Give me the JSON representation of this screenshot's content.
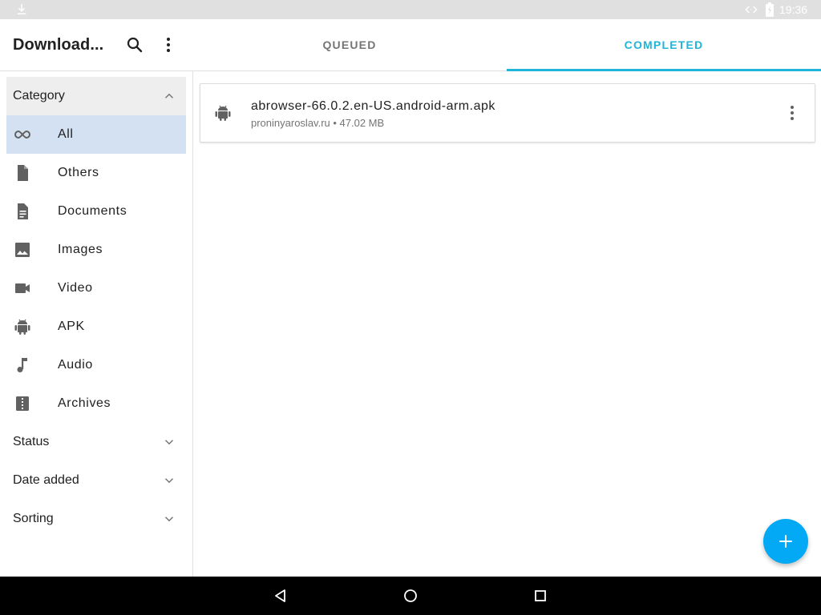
{
  "status_bar": {
    "time": "19:36",
    "icons": [
      "download-icon",
      "code-icon",
      "battery-icon"
    ]
  },
  "app_bar": {
    "title": "Download...",
    "search_icon": "search-icon",
    "overflow_icon": "more-vert-icon",
    "tabs": [
      {
        "label": "QUEUED",
        "active": false
      },
      {
        "label": "COMPLETED",
        "active": true
      }
    ]
  },
  "sidebar": {
    "category": {
      "label": "Category",
      "expanded": true,
      "items": [
        {
          "label": "All",
          "icon": "infinity-icon",
          "selected": true
        },
        {
          "label": "Others",
          "icon": "file-icon",
          "selected": false
        },
        {
          "label": "Documents",
          "icon": "document-icon",
          "selected": false
        },
        {
          "label": "Images",
          "icon": "image-icon",
          "selected": false
        },
        {
          "label": "Video",
          "icon": "video-icon",
          "selected": false
        },
        {
          "label": "APK",
          "icon": "android-icon",
          "selected": false
        },
        {
          "label": "Audio",
          "icon": "music-note-icon",
          "selected": false
        },
        {
          "label": "Archives",
          "icon": "archive-icon",
          "selected": false
        }
      ]
    },
    "status": {
      "label": "Status",
      "expanded": false
    },
    "date_added": {
      "label": "Date added",
      "expanded": false
    },
    "sorting": {
      "label": "Sorting",
      "expanded": false
    }
  },
  "downloads": [
    {
      "filename": "abrowser-66.0.2.en-US.android-arm.apk",
      "meta": "proninyaroslav.ru • 47.02 MB",
      "icon": "android-icon"
    }
  ],
  "fab": {
    "icon": "add-icon"
  },
  "nav_bar": {
    "icons": [
      "back-icon",
      "home-icon",
      "recents-icon"
    ]
  },
  "colors": {
    "accent": "#1fb5d8",
    "fab": "#03a9f4",
    "selected_bg": "#d3e1f2",
    "header_bg": "#eeeeee",
    "status_bar": "#e0e0e0"
  }
}
